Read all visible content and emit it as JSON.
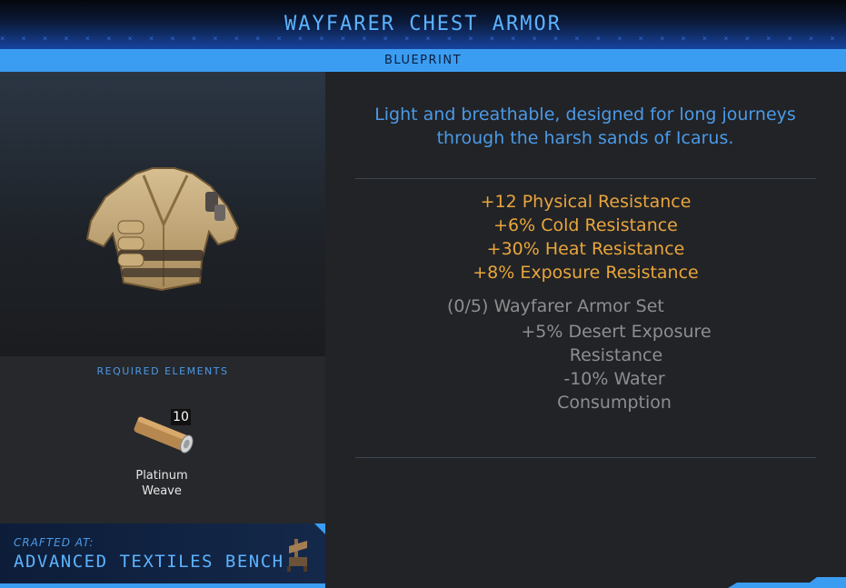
{
  "header": {
    "title": "WAYFARER CHEST ARMOR",
    "subtitle": "BLUEPRINT"
  },
  "item": {
    "name": "Wayfarer Chest Armor",
    "icon": "chest-armor-icon"
  },
  "requirements": {
    "title": "REQUIRED ELEMENTS",
    "items": [
      {
        "name_line1": "Platinum",
        "name_line2": "Weave",
        "count": "10",
        "icon": "platinum-weave-icon"
      }
    ]
  },
  "crafted_at": {
    "label": "CRAFTED AT:",
    "station": "ADVANCED TEXTILES BENCH",
    "icon": "textiles-bench-icon"
  },
  "description": {
    "line1": "Light and breathable, designed for long journeys",
    "line2": "through the harsh sands of Icarus."
  },
  "stats": [
    "+12 Physical Resistance",
    "+6% Cold Resistance",
    "+30% Heat Resistance",
    "+8% Exposure Resistance"
  ],
  "set": {
    "title": "(0/5) Wayfarer Armor Set",
    "bonus1_line1": "+5% Desert Exposure",
    "bonus1_line2": "Resistance",
    "bonus2": "-10% Water Consumption"
  },
  "colors": {
    "accent": "#3a9df2",
    "title": "#5cb3ff",
    "stat": "#e8a53c",
    "muted": "#8d8e90"
  }
}
